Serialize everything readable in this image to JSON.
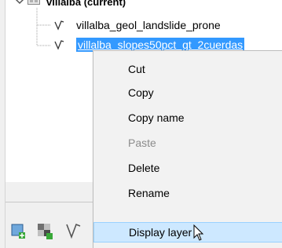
{
  "tree": {
    "group_label": "villalba  (current)",
    "layers": [
      {
        "label": "villalba_geol_landslide_prone",
        "selected": false
      },
      {
        "label": "villalba_slopes50pct_gt_2cuerdas",
        "selected": true
      }
    ]
  },
  "context_menu": {
    "items": [
      {
        "label": "Cut",
        "enabled": true
      },
      {
        "label": "Copy",
        "enabled": true
      },
      {
        "label": "Copy name",
        "enabled": true
      },
      {
        "label": "Paste",
        "enabled": false
      },
      {
        "label": "Delete",
        "enabled": true
      },
      {
        "label": "Rename",
        "enabled": true
      },
      {
        "label": "Display layer",
        "enabled": true,
        "hovered": true
      }
    ]
  },
  "toolbar": {
    "icons": [
      "add-layer-icon",
      "add-raster-icon",
      "add-vector-icon"
    ]
  },
  "colors": {
    "selection": "#3399ff",
    "menu_bg": "#f2f2f2",
    "menu_hover": "#cde8ff",
    "disabled_text": "#8c8c8c"
  }
}
